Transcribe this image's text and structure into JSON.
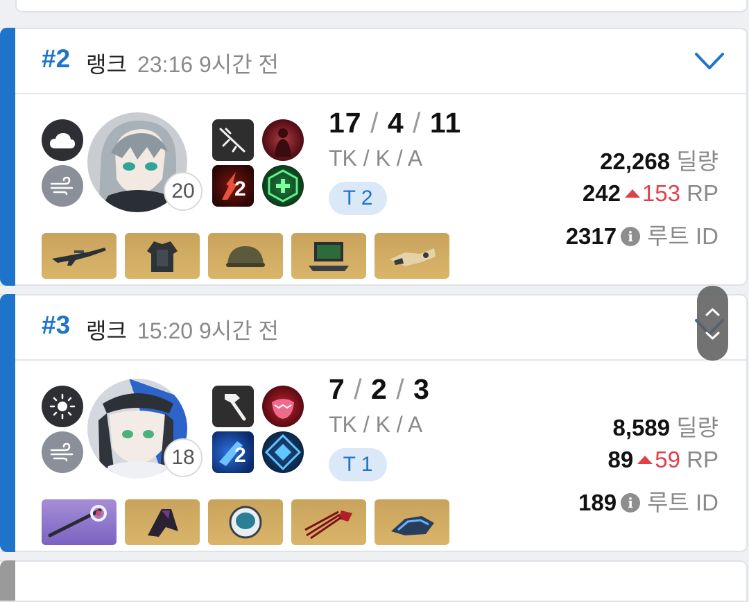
{
  "matches": [
    {
      "rank": "#2",
      "mode": "랭크",
      "time": "23:16 9시간 전",
      "level": "20",
      "kda": [
        "17",
        "4",
        "11"
      ],
      "kda_label": "TK / K / A",
      "tier": "T 2",
      "skill_count": "2",
      "damage_value": "22,268",
      "damage_label": "딜량",
      "rp_value": "242",
      "rp_delta": "153",
      "rp_label": "RP",
      "route_value": "2317",
      "route_label": "루트 ID",
      "info_glyph": "i",
      "weather": [
        "cloud-icon",
        "wind-icon"
      ],
      "items": [
        "rifle-item",
        "armor-item",
        "helmet-item",
        "device-item",
        "gauntlet-item"
      ],
      "item_colors": [
        "gold",
        "gold",
        "gold",
        "gold",
        "gold"
      ]
    },
    {
      "rank": "#3",
      "mode": "랭크",
      "time": "15:20 9시간 전",
      "level": "18",
      "kda": [
        "7",
        "2",
        "3"
      ],
      "kda_label": "TK / K / A",
      "tier": "T 1",
      "skill_count": "2",
      "damage_value": "8,589",
      "damage_label": "딜량",
      "rp_value": "89",
      "rp_delta": "59",
      "rp_label": "RP",
      "route_value": "189",
      "route_label": "루트 ID",
      "info_glyph": "i",
      "weather": [
        "sun-icon",
        "wind-icon"
      ],
      "items": [
        "spear-item",
        "cloak-item",
        "space-helmet-item",
        "claw-item",
        "blue-gauntlet-item"
      ],
      "item_colors": [
        "purple",
        "gold",
        "gold",
        "gold",
        "gold"
      ]
    }
  ],
  "colors": {
    "accent": "#1e74c8",
    "rp_up": "#e0404a",
    "item_gold": "#d2ad66",
    "item_purple": "#9179cc"
  }
}
